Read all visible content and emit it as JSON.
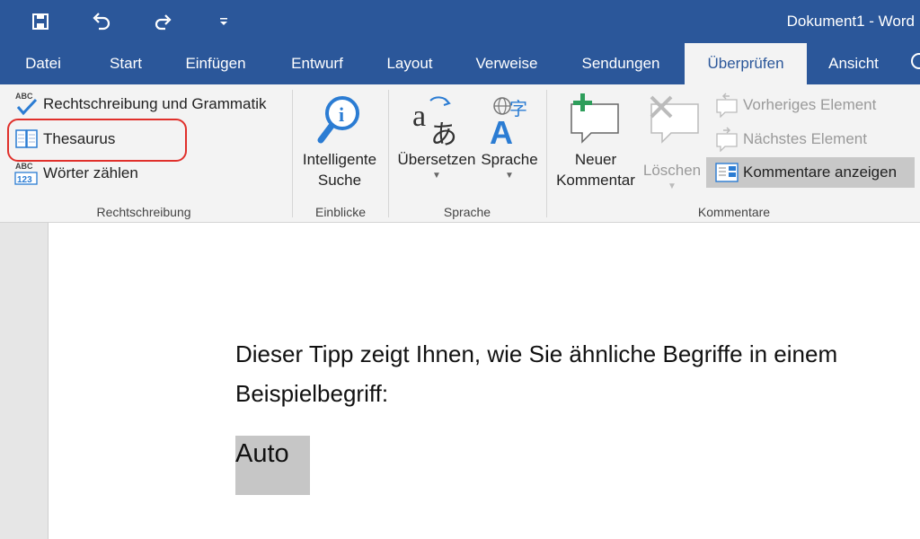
{
  "window": {
    "title": "Dokument1 - Word"
  },
  "quick_access": {
    "icons": [
      "save-icon",
      "undo-icon",
      "redo-icon",
      "customize-qat-icon"
    ]
  },
  "tabs": [
    "Datei",
    "Start",
    "Einfügen",
    "Entwurf",
    "Layout",
    "Verweise",
    "Sendungen",
    "Überprüfen",
    "Ansicht"
  ],
  "active_tab": "Überprüfen",
  "ribbon": {
    "rechtschreibung": {
      "label": "Rechtschreibung",
      "spelling": "Rechtschreibung und Grammatik",
      "thesaurus": "Thesaurus",
      "word_count": "Wörter zählen"
    },
    "einblicke": {
      "label": "Einblicke",
      "smart_lookup_line1": "Intelligente",
      "smart_lookup_line2": "Suche"
    },
    "sprache": {
      "label": "Sprache",
      "translate": "Übersetzen",
      "language": "Sprache"
    },
    "kommentare": {
      "label": "Kommentare",
      "new_comment_line1": "Neuer",
      "new_comment_line2": "Kommentar",
      "delete": "Löschen",
      "previous": "Vorheriges Element",
      "next": "Nächstes Element",
      "show_comments": "Kommentare anzeigen"
    }
  },
  "document": {
    "line1": "Dieser Tipp zeigt Ihnen, wie Sie ähnliche Begriffe in einem",
    "line2": "Beispielbegriff:",
    "selected_word": "Auto"
  },
  "colors": {
    "title_bar": "#2b579a",
    "ribbon_bg": "#f3f3f3",
    "highlight_ring": "#e0302b",
    "selection": "#c6c6c6"
  }
}
